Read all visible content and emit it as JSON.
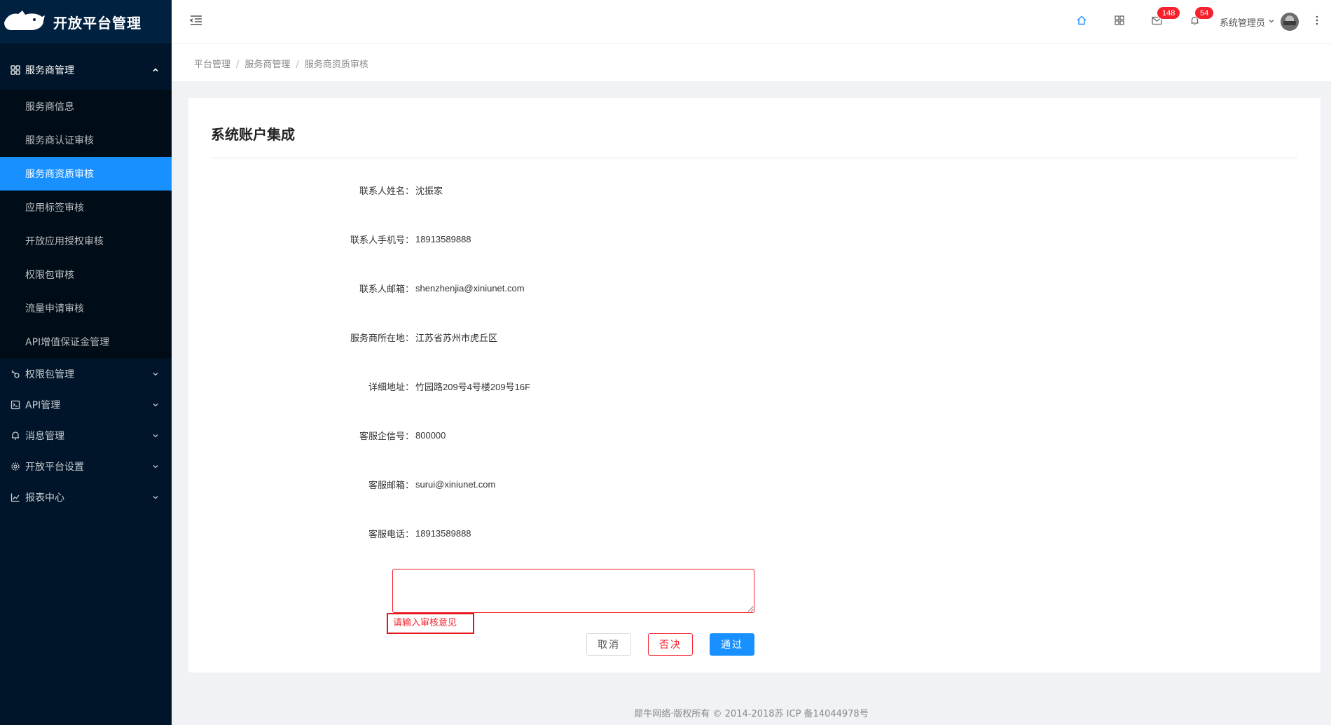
{
  "app": {
    "logo_text": "开放平台管理"
  },
  "sidebar": {
    "open_group": {
      "label": "服务商管理",
      "items": [
        {
          "label": "服务商信息",
          "active": false
        },
        {
          "label": "服务商认证审核",
          "active": false
        },
        {
          "label": "服务商资质审核",
          "active": true
        },
        {
          "label": "应用标签审核",
          "active": false
        },
        {
          "label": "开放应用授权审核",
          "active": false
        },
        {
          "label": "权限包审核",
          "active": false
        },
        {
          "label": "流量申请审核",
          "active": false
        },
        {
          "label": "API增值保证金管理",
          "active": false
        }
      ]
    },
    "groups": [
      {
        "label": "权限包管理",
        "icon": "permission-icon"
      },
      {
        "label": "API管理",
        "icon": "api-icon"
      },
      {
        "label": "消息管理",
        "icon": "bell-icon"
      },
      {
        "label": "开放平台设置",
        "icon": "gear-icon"
      },
      {
        "label": "报表中心",
        "icon": "chart-icon"
      }
    ]
  },
  "header": {
    "mail_count": "148",
    "notice_count": "54",
    "user_name": "系统管理员"
  },
  "breadcrumb": [
    "平台管理",
    "服务商管理",
    "服务商资质审核"
  ],
  "card": {
    "title": "系统账户集成",
    "fields": [
      {
        "label": "联系人姓名：",
        "value": "沈振家"
      },
      {
        "label": "联系人手机号：",
        "value": "18913589888"
      },
      {
        "label": "联系人邮箱：",
        "value": "shenzhenjia@xiniunet.com"
      },
      {
        "label": "服务商所在地：",
        "value": "江苏省苏州市虎丘区"
      },
      {
        "label": "详细地址：",
        "value": "竹园路209号4号楼209号16F"
      },
      {
        "label": "客服企信号：",
        "value": "800000"
      },
      {
        "label": "客服邮箱：",
        "value": "surui@xiniunet.com"
      },
      {
        "label": "客服电话：",
        "value": "18913589888"
      }
    ],
    "opinion_value": "",
    "error_tip": "请输入审核意见",
    "buttons": {
      "cancel": "取消",
      "reject": "否决",
      "pass": "通过"
    }
  },
  "footer": {
    "text": "犀牛网络·版权所有 © 2014-2018苏 ICP 备14044978号"
  },
  "colors": {
    "sidebar_bg": "#001529",
    "submenu_bg": "#000c17",
    "accent": "#1890ff",
    "danger": "#f5222d"
  }
}
